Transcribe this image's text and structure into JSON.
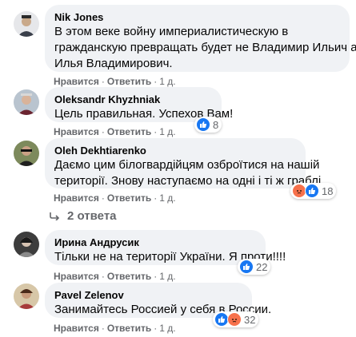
{
  "comments": [
    {
      "author": "Nik Jones",
      "lines": [
        "В этом веке войну империалистическую в",
        "гражданскую превращать будет не Владимир Ильич а",
        "Илья Владимирович."
      ],
      "like_label": "Нравится",
      "reply_label": "Ответить",
      "time": "1 д."
    },
    {
      "author": "Oleksandr Khyzhniak",
      "lines": [
        "Цель правильная. Успехов Вам!"
      ],
      "like_label": "Нравится",
      "reply_label": "Ответить",
      "time": "1 д.",
      "reaction_count": "8",
      "reactions": [
        "like-icon"
      ]
    },
    {
      "author": "Oleh Dekhtiarenko",
      "lines": [
        "Даємо цим білогвардійцям озброїтися на нашій",
        "території. Знову наступаємо на одні і ті ж граблі."
      ],
      "like_label": "Нравится",
      "reply_label": "Ответить",
      "time": "1 д.",
      "reaction_count": "18",
      "reactions": [
        "angry-icon",
        "like-icon"
      ]
    },
    {
      "author": "Ирина Андрусик",
      "lines": [
        "Тільки не на території України. Я проти!!!!"
      ],
      "like_label": "Нравится",
      "reply_label": "Ответить",
      "time": "1 д.",
      "reaction_count": "22",
      "reactions": [
        "like-icon"
      ]
    },
    {
      "author": "Pavel Zelenov",
      "lines": [
        "Занимайтесь Россией у себя в России."
      ],
      "like_label": "Нравится",
      "reply_label": "Ответить",
      "time": "1 д.",
      "reaction_count": "32",
      "reactions": [
        "like-icon",
        "angry-icon"
      ]
    }
  ],
  "replies_label": "2 ответа",
  "colors": {
    "bubble": "#f0f2f5",
    "meta": "#65676b",
    "like": "#1877f2",
    "angry": "#f7714c"
  }
}
